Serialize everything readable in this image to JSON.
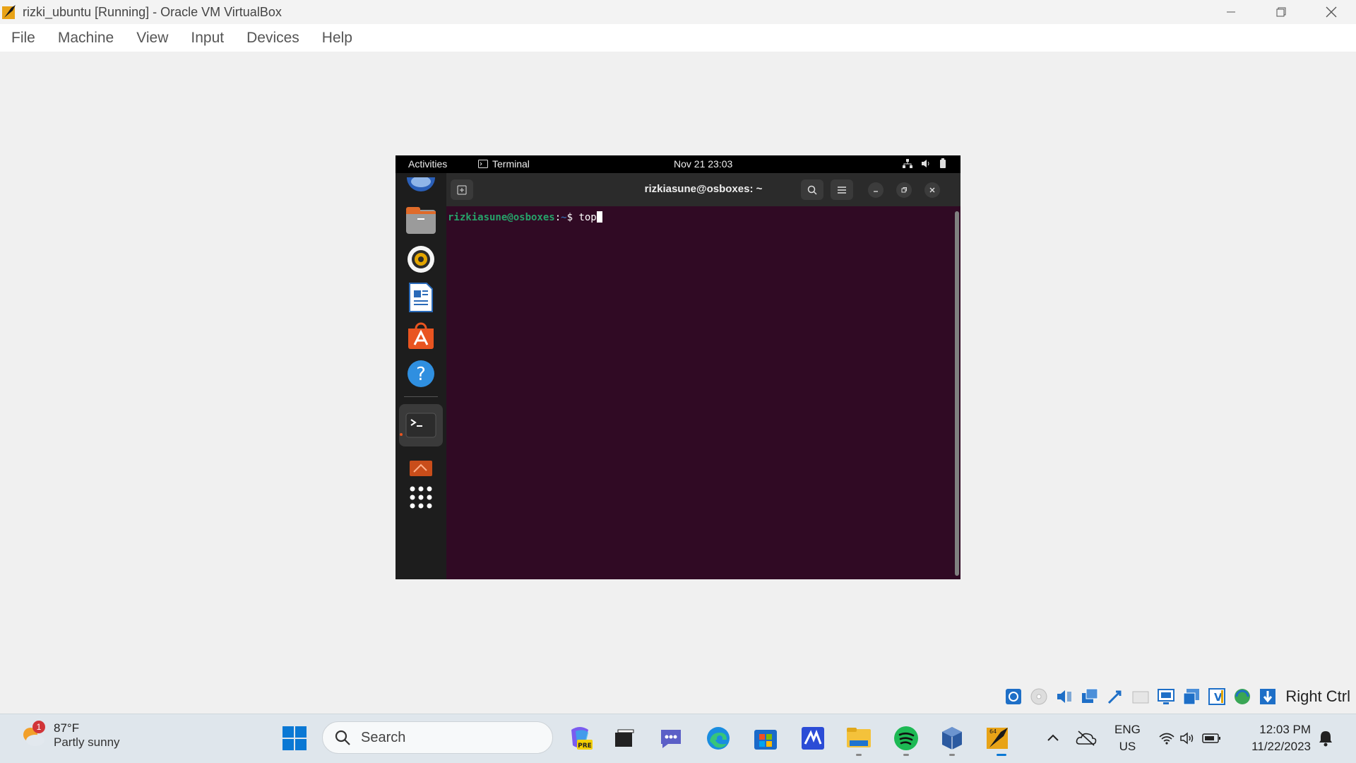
{
  "window": {
    "title": "rizki_ubuntu [Running] - Oracle VM VirtualBox",
    "controls": [
      "minimize-icon",
      "restore-icon",
      "close-icon"
    ]
  },
  "menubar": {
    "items": [
      {
        "label": "File"
      },
      {
        "label": "Machine"
      },
      {
        "label": "View"
      },
      {
        "label": "Input"
      },
      {
        "label": "Devices"
      },
      {
        "label": "Help"
      }
    ]
  },
  "guest": {
    "topbar": {
      "activities": "Activities",
      "app_name": "Terminal",
      "clock": "Nov 21  23:03"
    },
    "dock": {
      "items": [
        "thunderbird-icon",
        "files-icon",
        "rhythmbox-icon",
        "writer-icon",
        "software-icon",
        "help-icon",
        "terminal-icon",
        "removable-icon",
        "app-grid-icon"
      ]
    },
    "terminal": {
      "title": "rizkiasune@osboxes: ~",
      "prompt_user": "rizkiasune@osboxes",
      "prompt_sep": ":",
      "prompt_path": "~",
      "prompt_symbol": "$ ",
      "command": "top"
    }
  },
  "statusbar": {
    "host_key": "Right Ctrl"
  },
  "taskbar": {
    "weather": {
      "temp": "87°F",
      "desc": "Partly sunny",
      "badge": "1"
    },
    "search_placeholder": "Search",
    "lang_top": "ENG",
    "lang_bottom": "US",
    "time": "12:03 PM",
    "date": "11/22/2023"
  }
}
